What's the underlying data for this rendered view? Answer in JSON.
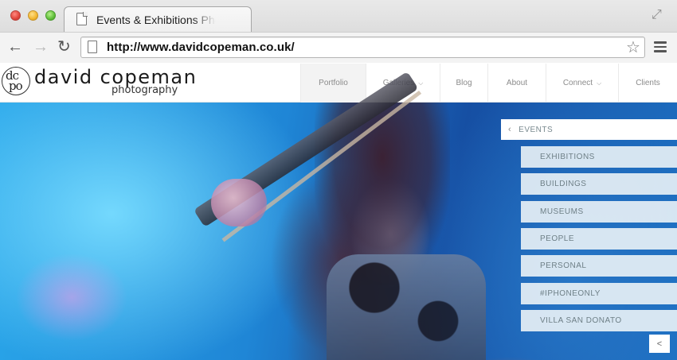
{
  "browser": {
    "tab_title": "Events & Exhibitions Pho",
    "url": "http://www.davidcopeman.co.uk/",
    "icons": [
      "close-window-icon",
      "minimize-window-icon",
      "zoom-window-icon",
      "back-arrow-icon",
      "forward-arrow-icon",
      "reload-icon",
      "page-icon",
      "star-icon",
      "menu-icon",
      "fullscreen-icon"
    ]
  },
  "site": {
    "logo": {
      "mark_top": "dc",
      "mark_bottom": "po",
      "name": "david copeman",
      "tagline": "photography"
    },
    "nav": [
      {
        "label": "Portfolio",
        "active": true,
        "dropdown": false
      },
      {
        "label": "Galleries",
        "active": false,
        "dropdown": true
      },
      {
        "label": "Blog",
        "active": false,
        "dropdown": false
      },
      {
        "label": "About",
        "active": false,
        "dropdown": false
      },
      {
        "label": "Connect",
        "active": false,
        "dropdown": true
      },
      {
        "label": "Clients",
        "active": false,
        "dropdown": false
      }
    ],
    "category_menu": {
      "back_label": "EVENTS",
      "items": [
        "EXHIBITIONS",
        "BUILDINGS",
        "MUSEUMS",
        "PEOPLE",
        "PERSONAL",
        "#IPHONEONLY",
        "VILLA SAN DONATO"
      ]
    },
    "share_icon": "share-icon"
  }
}
